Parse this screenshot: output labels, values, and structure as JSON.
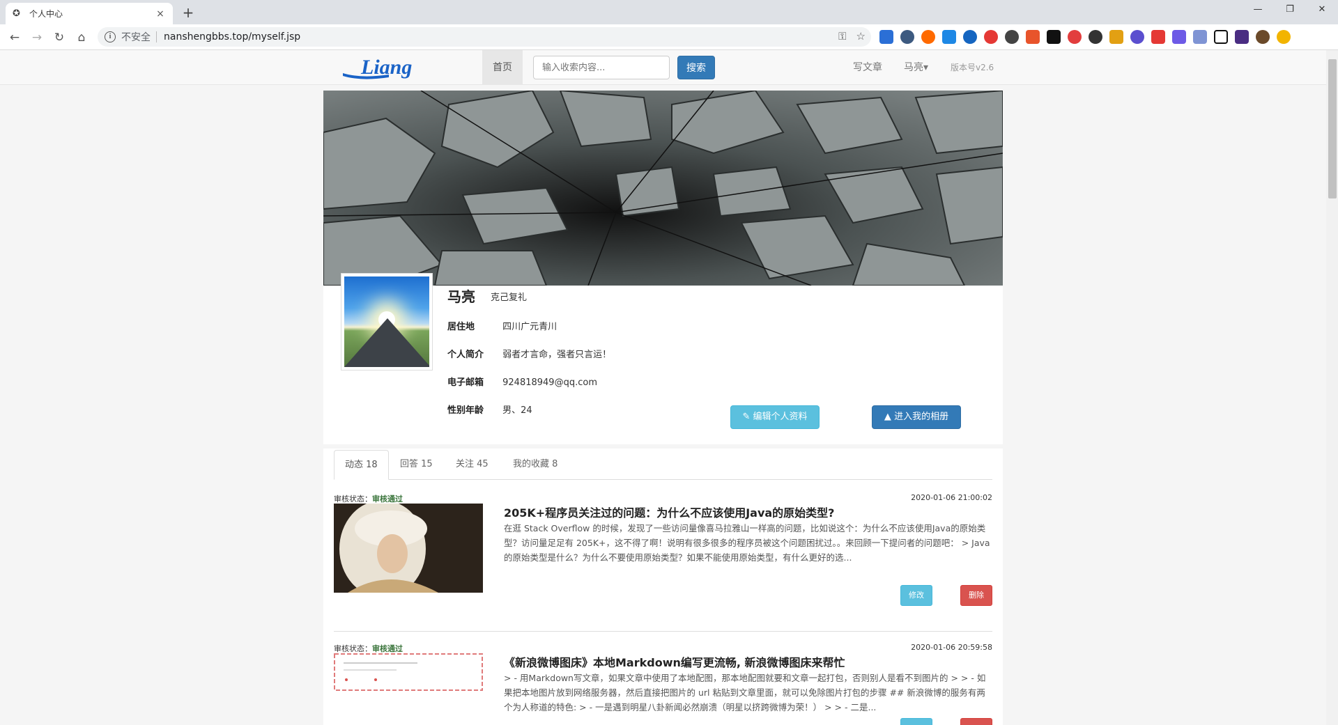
{
  "browser": {
    "tab_title": "个人中心",
    "tab_close": "×",
    "new_tab": "+",
    "security_label": "不安全",
    "url": "nanshengbbs.top/myself.jsp"
  },
  "site": {
    "logo_text": "Liang",
    "nav": {
      "home": "首页",
      "search_placeholder": "输入收索内容...",
      "search_button": "搜索",
      "write": "写文章",
      "user_menu": "马亮▾",
      "version": "版本号v2.6"
    },
    "profile": {
      "name": "马亮",
      "motto": "克己复礼",
      "location_label": "居住地",
      "location": "四川广元青川",
      "bio_label": "个人简介",
      "bio": "弱者才言命，强者只言运！",
      "email_label": "电子邮箱",
      "email": "924818949@qq.com",
      "gender_age_label": "性别年龄",
      "gender_age": "男、24",
      "edit_button": "编辑个人资料",
      "album_button": "进入我的相册"
    },
    "tabs": [
      "动态 18",
      "回答 15",
      "关注 45",
      "我的收藏 8"
    ],
    "posts": [
      {
        "status_label": "审核状态：",
        "status": "审核通过",
        "date": "2020-01-06 21:00:02",
        "title": "205K+程序员关注过的问题：为什么不应该使用Java的原始类型?",
        "body": "在逛 Stack Overflow 的时候，发现了一些访问量像喜马拉雅山一样高的问题，比如说这个：为什么不应该使用Java的原始类型？访问量足足有 205K+，这不得了啊！说明有很多很多的程序员被这个问题困扰过。。来回顾一下提问者的问题吧： > Java 的原始类型是什么？为什么不要使用原始类型？如果不能使用原始类型，有什么更好的选...",
        "edit": "修改",
        "delete": "删除"
      },
      {
        "status_label": "审核状态：",
        "status": "审核通过",
        "date": "2020-01-06 20:59:58",
        "title": "《新浪微博图床》本地Markdown编写更流畅, 新浪微博图床来帮忙",
        "body": "> - 用Markdown写文章，如果文章中使用了本地配图，那本地配图就要和文章一起打包，否则别人是看不到图片的 > > - 如果把本地图片放到网络服务器，然后直接把图片的 url 粘贴到文章里面，就可以免除图片打包的步骤 ## 新浪微博的服务有两个为人称道的特色: > - 一是遇到明星八卦新闻必然崩溃（明星以挤跨微博为荣！） > > - 二是..."
      }
    ]
  }
}
